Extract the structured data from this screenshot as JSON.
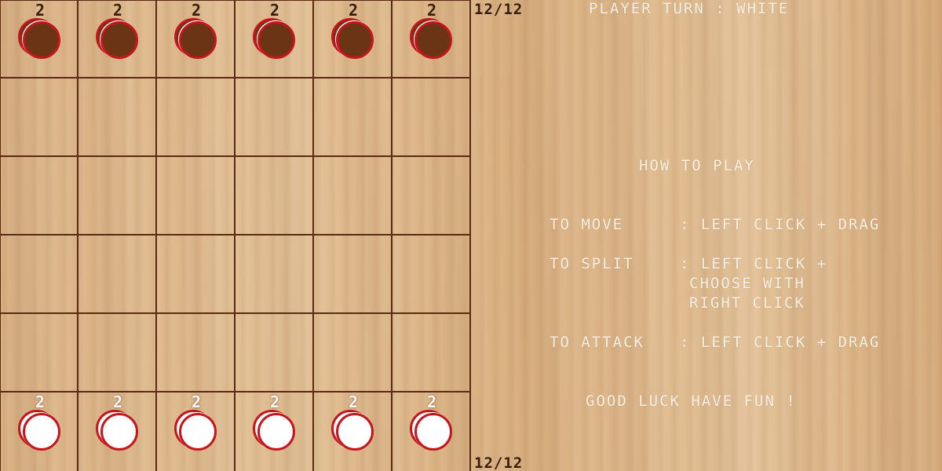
{
  "board": {
    "top_row_counts": [
      "2",
      "2",
      "2",
      "2",
      "2",
      "2"
    ],
    "bottom_row_counts": [
      "2",
      "2",
      "2",
      "2",
      "2",
      "2"
    ],
    "colors": {
      "grid_line": "#5a2a12",
      "disc_outline": "#c4161c",
      "black_disc": "#6b3515",
      "white_disc": "#ffffff"
    }
  },
  "counters": {
    "top": "12/12",
    "bottom": "12/12"
  },
  "status": {
    "turn": "PLAYER TURN : WHITE"
  },
  "instructions": {
    "title": "HOW TO PLAY",
    "move_label": "TO MOVE",
    "move_value": ": LEFT CLICK + DRAG",
    "split_label": "TO SPLIT",
    "split_value_1": ": LEFT CLICK +",
    "split_value_2": "CHOOSE WITH",
    "split_value_3": "RIGHT CLICK",
    "attack_label": "TO ATTACK",
    "attack_value": ": LEFT CLICK + DRAG",
    "footer": "GOOD LUCK HAVE FUN !"
  }
}
